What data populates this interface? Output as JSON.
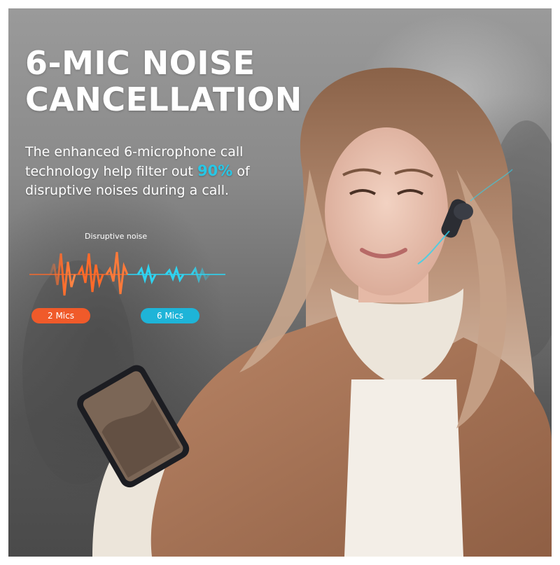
{
  "headline": {
    "line1": "6-MIC NOISE",
    "line2": "CANCELLATION"
  },
  "description": {
    "part1": "The enhanced 6-microphone call technology help filter out ",
    "highlight": "90%",
    "part2": " of disruptive noises during a call."
  },
  "diagram": {
    "noise_label": "Disruptive noise",
    "mics_2_label": "2 Mics",
    "mics_6_label": "6 Mics"
  },
  "colors": {
    "highlight": "#27c7e6",
    "orange": "#f05a2a",
    "cyan": "#1eb4d8"
  }
}
